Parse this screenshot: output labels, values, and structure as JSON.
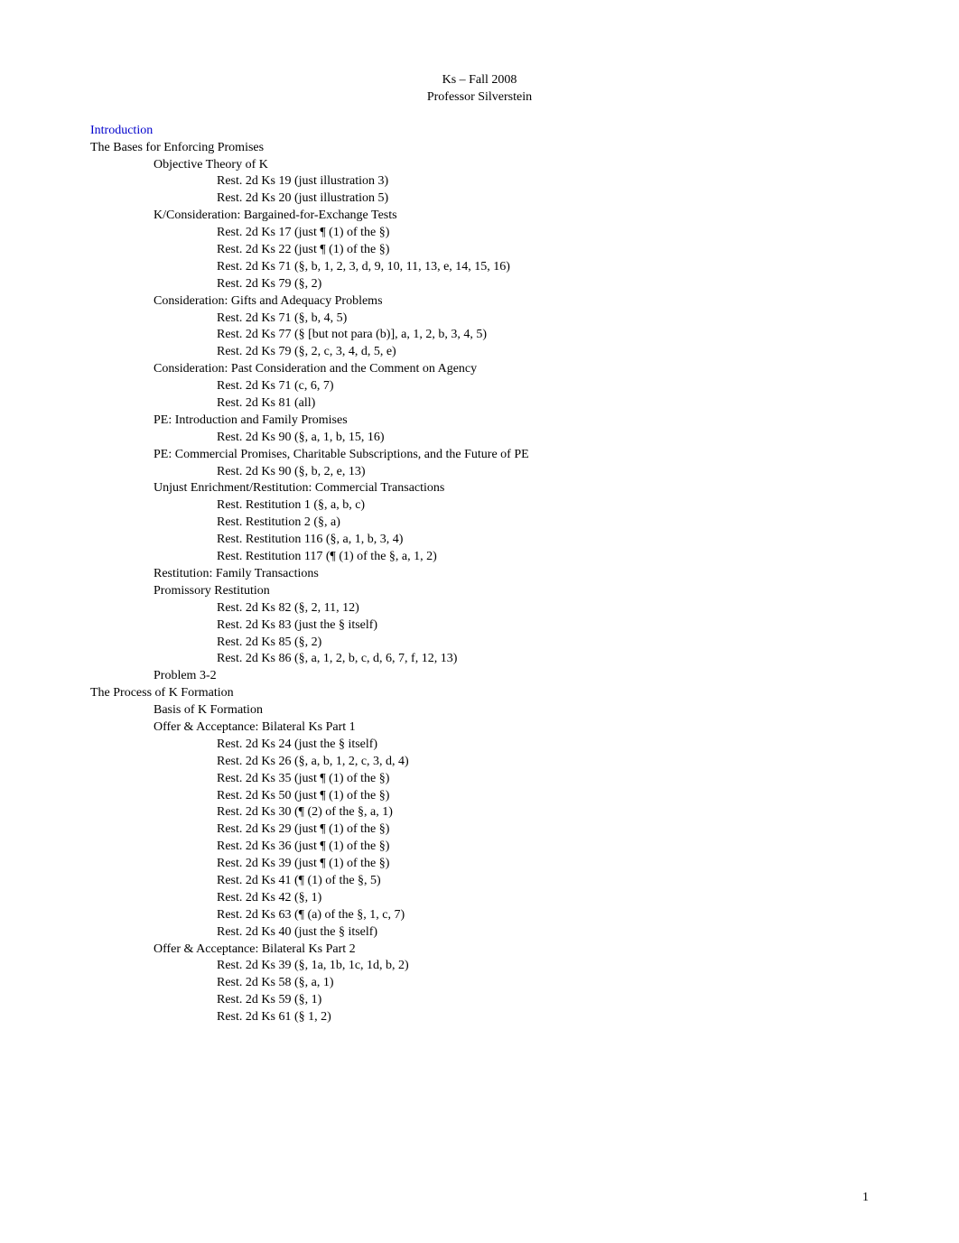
{
  "header": {
    "line1": "Ks – Fall 2008",
    "line2": "Professor Silverstein"
  },
  "intro_label": "Introduction",
  "outline": [
    {
      "level": 0,
      "text": "The Bases for Enforcing Promises"
    },
    {
      "level": 1,
      "text": "Objective Theory of K"
    },
    {
      "level": 2,
      "text": "Rest. 2d Ks 19 (just illustration 3)"
    },
    {
      "level": 2,
      "text": "Rest. 2d Ks 20 (just illustration 5)"
    },
    {
      "level": 1,
      "text": "K/Consideration: Bargained-for-Exchange Tests"
    },
    {
      "level": 2,
      "text": "Rest. 2d Ks 17 (just ¶ (1) of the §)"
    },
    {
      "level": 2,
      "text": "Rest. 2d Ks 22 (just ¶ (1) of the §)"
    },
    {
      "level": 2,
      "text": "Rest. 2d Ks 71 (§, b, 1, 2, 3, d, 9, 10, 11, 13, e, 14, 15, 16)"
    },
    {
      "level": 2,
      "text": "Rest. 2d Ks 79 (§, 2)"
    },
    {
      "level": 1,
      "text": "Consideration: Gifts and Adequacy Problems"
    },
    {
      "level": 2,
      "text": "Rest. 2d Ks 71 (§, b, 4, 5)"
    },
    {
      "level": 2,
      "text": "Rest. 2d Ks 77 (§ [but not para (b)], a, 1, 2, b, 3, 4, 5)"
    },
    {
      "level": 2,
      "text": "Rest. 2d Ks 79 (§, 2, c, 3, 4, d, 5, e)"
    },
    {
      "level": 1,
      "text": "Consideration: Past Consideration and the Comment on Agency"
    },
    {
      "level": 2,
      "text": "Rest. 2d Ks 71 (c, 6, 7)"
    },
    {
      "level": 2,
      "text": "Rest. 2d Ks 81 (all)"
    },
    {
      "level": 1,
      "text": "PE: Introduction and Family Promises"
    },
    {
      "level": 2,
      "text": "Rest. 2d Ks 90 (§, a, 1, b, 15, 16)"
    },
    {
      "level": 1,
      "text": "PE: Commercial Promises, Charitable Subscriptions, and the Future of PE"
    },
    {
      "level": 2,
      "text": "Rest. 2d Ks 90 (§, b, 2, e, 13)"
    },
    {
      "level": 1,
      "text": "Unjust Enrichment/Restitution: Commercial Transactions"
    },
    {
      "level": 2,
      "text": "Rest. Restitution 1 (§, a, b, c)"
    },
    {
      "level": 2,
      "text": "Rest. Restitution 2 (§, a)"
    },
    {
      "level": 2,
      "text": "Rest. Restitution 116 (§, a, 1, b, 3, 4)"
    },
    {
      "level": 2,
      "text": "Rest. Restitution 117 (¶ (1) of the §, a, 1, 2)"
    },
    {
      "level": 1,
      "text": "Restitution: Family Transactions"
    },
    {
      "level": 1,
      "text": "Promissory Restitution"
    },
    {
      "level": 2,
      "text": "Rest. 2d Ks 82 (§, 2, 11, 12)"
    },
    {
      "level": 2,
      "text": "Rest. 2d Ks 83 (just the § itself)"
    },
    {
      "level": 2,
      "text": "Rest. 2d Ks 85 (§, 2)"
    },
    {
      "level": 2,
      "text": "Rest. 2d Ks 86 (§, a, 1, 2, b, c, d, 6, 7, f, 12, 13)"
    },
    {
      "level": 1,
      "text": "Problem 3-2"
    },
    {
      "level": 0,
      "text": "The Process of K Formation"
    },
    {
      "level": 1,
      "text": "Basis of K Formation"
    },
    {
      "level": 1,
      "text": "Offer & Acceptance: Bilateral Ks Part 1"
    },
    {
      "level": 2,
      "text": "Rest. 2d Ks 24 (just the § itself)"
    },
    {
      "level": 2,
      "text": "Rest. 2d Ks 26 (§, a, b, 1, 2, c, 3, d, 4)"
    },
    {
      "level": 2,
      "text": "Rest. 2d Ks 35 (just ¶ (1) of the §)"
    },
    {
      "level": 2,
      "text": "Rest. 2d Ks 50 (just ¶ (1) of the §)"
    },
    {
      "level": 2,
      "text": "Rest. 2d Ks 30 (¶ (2) of the §, a, 1)"
    },
    {
      "level": 2,
      "text": "Rest. 2d Ks 29 (just ¶ (1) of the §)"
    },
    {
      "level": 2,
      "text": "Rest. 2d Ks 36 (just ¶ (1) of the §)"
    },
    {
      "level": 2,
      "text": "Rest. 2d Ks 39 (just ¶ (1) of the §)"
    },
    {
      "level": 2,
      "text": "Rest. 2d Ks 41 (¶ (1) of the §, 5)"
    },
    {
      "level": 2,
      "text": "Rest. 2d Ks 42 (§, 1)"
    },
    {
      "level": 2,
      "text": "Rest. 2d Ks 63 (¶ (a) of the §, 1, c, 7)"
    },
    {
      "level": 2,
      "text": "Rest. 2d Ks 40 (just the § itself)"
    },
    {
      "level": 1,
      "text": "Offer & Acceptance: Bilateral Ks Part 2"
    },
    {
      "level": 2,
      "text": "Rest. 2d Ks 39 (§, 1a, 1b, 1c, 1d, b, 2)"
    },
    {
      "level": 2,
      "text": "Rest. 2d Ks 58 (§, a, 1)"
    },
    {
      "level": 2,
      "text": "Rest. 2d Ks 59 (§, 1)"
    },
    {
      "level": 2,
      "text": "Rest. 2d Ks 61 (§ 1, 2)"
    }
  ],
  "page_number": "1"
}
